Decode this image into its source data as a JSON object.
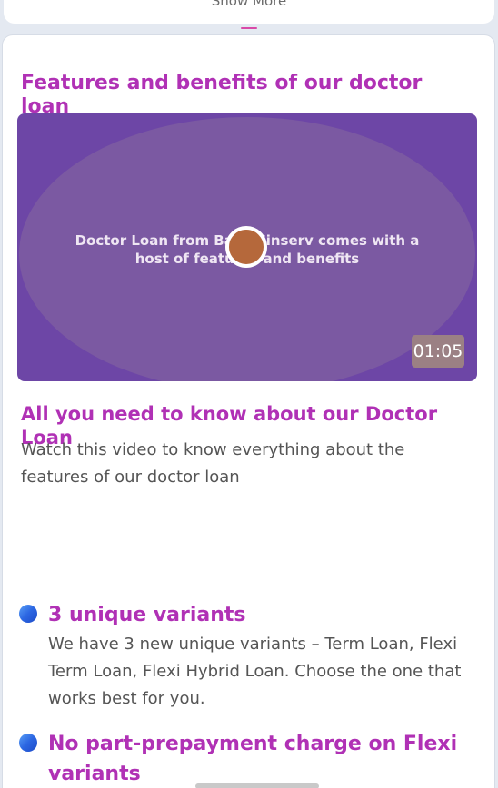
{
  "previous_card": {
    "label": "Show More"
  },
  "benefits": {
    "title": "Features and benefits of our doctor loan",
    "video": {
      "caption": "Doctor Loan from Bajaj Finserv comes with a host of features and benefits",
      "duration": "01:05",
      "play_icon": "play-icon"
    },
    "video_title": "All you need to know about our Doctor Loan",
    "video_description": "Watch this video to know everything about the features of our doctor loan",
    "features": [
      {
        "icon": "bullet-dot-icon",
        "title": "3 unique variants",
        "description": "We have 3 new unique variants – Term Loan, Flexi Term Loan, Flexi Hybrid Loan. Choose the one that works best for you."
      },
      {
        "icon": "bullet-dot-icon",
        "title": "No part-prepayment charge on Flexi variants",
        "description": ""
      }
    ]
  },
  "colors": {
    "accent": "#b031b5",
    "video_background": "#6d46a6",
    "bullet": "#2c66e2"
  }
}
